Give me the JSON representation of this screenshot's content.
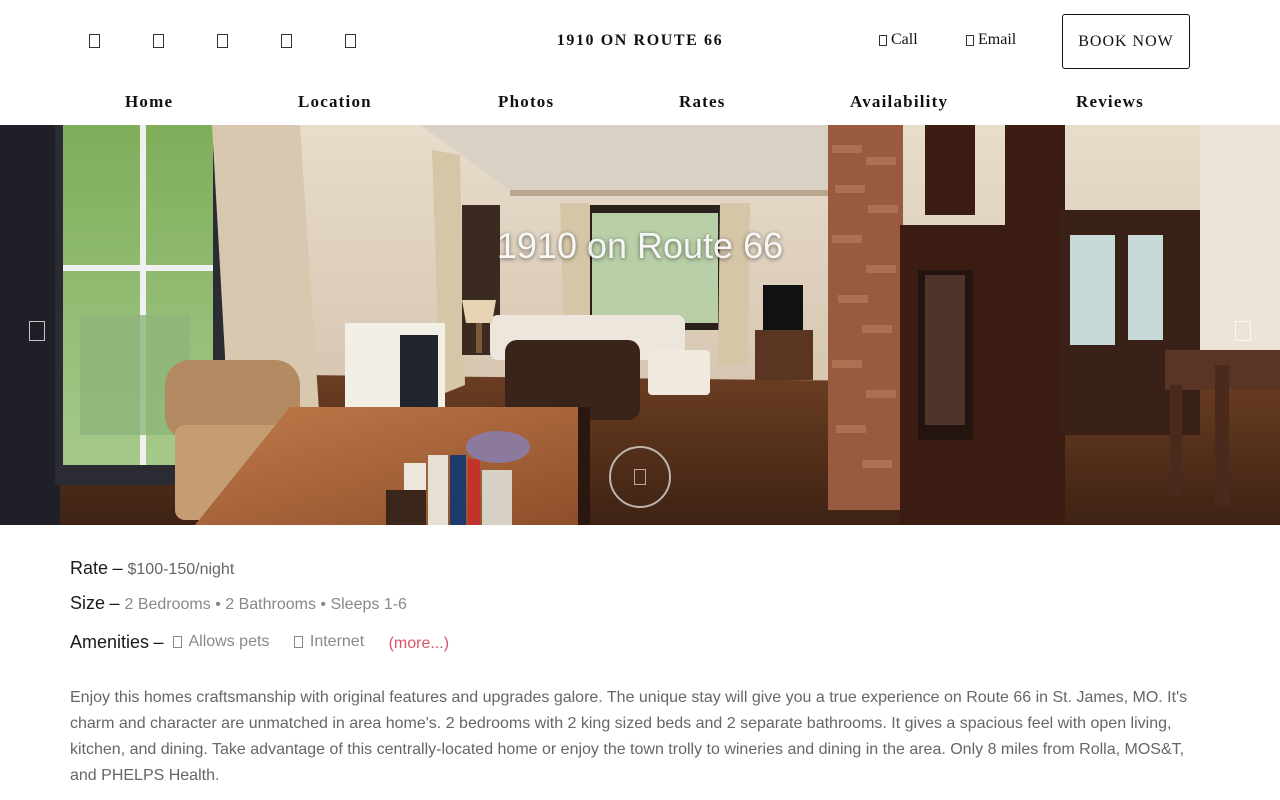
{
  "header": {
    "social_icons": [
      "facebook-icon",
      "instagram-icon",
      "twitter-icon",
      "pinterest-icon",
      "youtube-icon"
    ],
    "site_title": "1910 ON ROUTE 66",
    "call_label": "Call",
    "email_label": "Email",
    "book_label": "BOOK NOW"
  },
  "nav": {
    "items": [
      "Home",
      "Location",
      "Photos",
      "Rates",
      "Availability",
      "Reviews"
    ]
  },
  "hero": {
    "title": "1910 on Route 66",
    "prev_icon": "chevron-left-icon",
    "next_icon": "chevron-right-icon",
    "play_icon": "play-icon"
  },
  "details": {
    "rate_label": "Rate",
    "rate_value": "$100-150/night",
    "size_label": "Size",
    "size_value": "2 Bedrooms • 2 Bathrooms • Sleeps 1-6",
    "amenities_label": "Amenities",
    "amenities": [
      "Allows pets",
      "Internet"
    ],
    "more_label": "(more...)",
    "description": "Enjoy this homes craftsmanship with original features and upgrades galore. The unique stay will give you a true experience on Route 66 in St. James, MO. It's charm and character are unmatched in area home's. 2 bedrooms with 2 king sized beds and 2 separate bathrooms. It gives a spacious feel with open living, kitchen, and dining. Take advantage of this centrally-located home or enjoy the town trolly to wineries and dining in the area. Only 8 miles from Rolla, MOS&T, and PHELPS Health."
  },
  "colors": {
    "accent_link": "#d9536a",
    "text_muted": "#888888"
  }
}
